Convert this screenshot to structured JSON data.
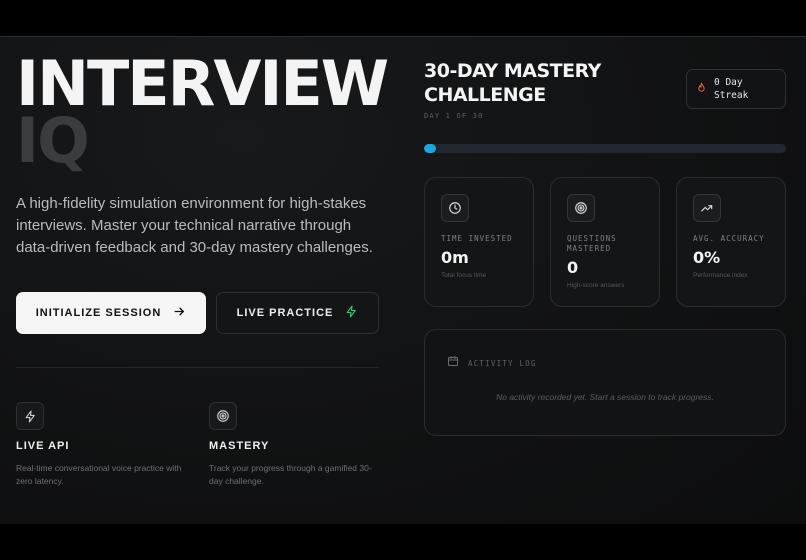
{
  "hero": {
    "title_line1": "INTERVIEW",
    "title_line2": "IQ",
    "description": "A high-fidelity simulation environment for high-stakes interviews. Master your technical narrative through data-driven feedback and 30-day mastery challenges."
  },
  "actions": {
    "primary_label": "INITIALIZE SESSION",
    "primary_icon": "arrow-right-icon",
    "secondary_label": "LIVE PRACTICE",
    "secondary_icon": "bolt-icon"
  },
  "features": [
    {
      "icon": "bolt-icon",
      "title": "LIVE API",
      "text": "Real-time conversational voice practice with zero latency."
    },
    {
      "icon": "target-icon",
      "title": "MASTERY",
      "text": "Track your progress through a gamified 30-day challenge."
    }
  ],
  "challenge": {
    "title": "30-DAY MASTERY CHALLENGE",
    "subtitle": "DAY 1 OF 30",
    "progress": 0.033,
    "streak_line1": "0 Day",
    "streak_line2": "Streak",
    "streak_icon": "flame-icon"
  },
  "stats": [
    {
      "icon": "clock-icon",
      "label": "TIME INVESTED",
      "value": "0m",
      "caption": "Total focus time"
    },
    {
      "icon": "target-icon",
      "label": "QUESTIONS MASTERED",
      "value": "0",
      "caption": "High-score answers"
    },
    {
      "icon": "trending-up-icon",
      "label": "AVG. ACCURACY",
      "value": "0%",
      "caption": "Performance index"
    }
  ],
  "activity": {
    "label": "ACTIVITY LOG",
    "empty_message": "No activity recorded yet. Start a session to track progress."
  },
  "colors": {
    "accent": "#1aa8e0",
    "bolt": "#2fd07a",
    "flame": "#ff6a3d",
    "background": "#111213"
  }
}
